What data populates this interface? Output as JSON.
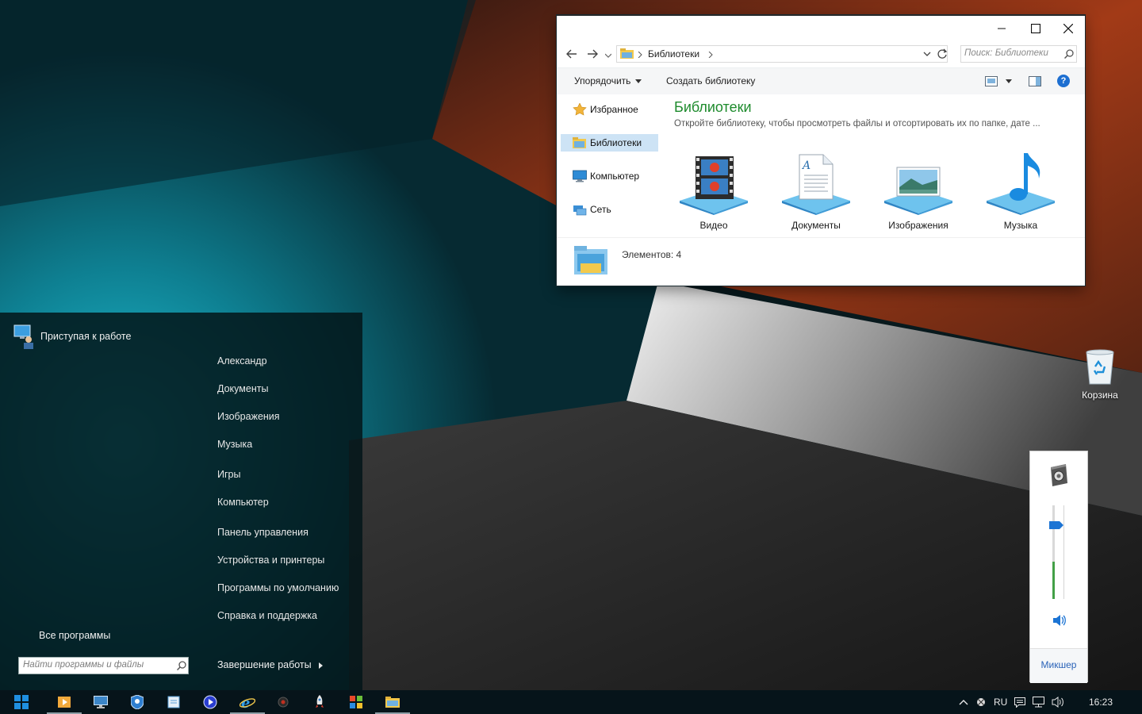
{
  "explorer": {
    "address_crumb": "Библиотеки",
    "search_placeholder": "Поиск: Библиотеки",
    "organize_label": "Упорядочить",
    "new_library_label": "Создать библиотеку",
    "nav_items": [
      {
        "label": "Избранное",
        "icon": "star-icon"
      },
      {
        "label": "Библиотеки",
        "icon": "libraries-folder-icon",
        "selected": true
      },
      {
        "label": "Компьютер",
        "icon": "computer-icon"
      },
      {
        "label": "Сеть",
        "icon": "network-icon"
      }
    ],
    "content_title": "Библиотеки",
    "content_subtitle": "Откройте библиотеку, чтобы просмотреть файлы и отсортировать их по папке, дате ...",
    "libraries": [
      {
        "label": "Видео",
        "icon": "video-library-icon"
      },
      {
        "label": "Документы",
        "icon": "documents-library-icon"
      },
      {
        "label": "Изображения",
        "icon": "pictures-library-icon"
      },
      {
        "label": "Музыка",
        "icon": "music-library-icon"
      }
    ],
    "item_count": "Элементов: 4",
    "help_glyph": "?"
  },
  "start_menu": {
    "getting_started": "Приступая к работе",
    "right_items": [
      "Александр",
      "Документы",
      "Изображения",
      "Музыка",
      "Игры",
      "Компьютер",
      "Панель управления",
      "Устройства и принтеры",
      "Программы по умолчанию",
      "Справка и поддержка"
    ],
    "all_programs": "Все программы",
    "search_placeholder": "Найти программы и файлы",
    "shutdown": "Завершение работы"
  },
  "desktop": {
    "recycle_bin_label": "Корзина"
  },
  "volume": {
    "mixer_label": "Микшер",
    "level_fraction": 0.83
  },
  "taskbar": {
    "language": "RU",
    "clock": "16:23",
    "pinned": [
      "start-button",
      "media-player-icon",
      "monitor-icon",
      "security-shield-icon",
      "notepad-icon",
      "media-play-icon",
      "internet-explorer-icon",
      "record-icon",
      "rocket-icon",
      "store-tiles-icon",
      "file-explorer-icon"
    ]
  },
  "colors": {
    "accent_green_title": "#1e8b2d",
    "selection": "#cde3f5",
    "start_menu_bg": "#04161a",
    "taskbar_bg": "#06141a",
    "link_blue": "#2a63b8"
  }
}
